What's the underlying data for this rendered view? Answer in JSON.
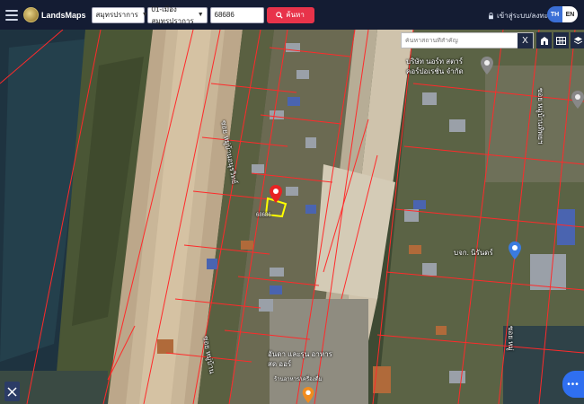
{
  "header": {
    "app_name": "LandsMaps",
    "province_select": "สมุทรปราการ",
    "district_select": "01-เมืองสมุทรปราการ",
    "parcel_number": "68686",
    "search_button": "ค้นหา",
    "login_link": "เข้าสู่ระบบ/ลงทะเบียน",
    "lang_th": "TH",
    "lang_en": "EN"
  },
  "map": {
    "place_search_placeholder": "ค้นหาสถานที่สำคัญ",
    "close_label": "X",
    "labels": {
      "road_left": "ซอย หมู่บ้านอนุรวิทย์",
      "road_left_bottom": "ซอย หมู่บ้าน",
      "road_right_top": "ซอย หมู่บ้านทิพยฯ",
      "road_right_bottom": "ซอย หมู่",
      "company": "บริษัท นอร์ท สตาร์ คอร์ปอเรชั่น จำกัด",
      "poi_right": "บจก. นิรันดร์",
      "poi_bottom": "อันดา และรุน อาหาร สด ออร์",
      "poi_bottom_sub": "ร้านอาหาร/เครื่องดื่ม",
      "parcel": "68686"
    },
    "fab_label": "•••"
  }
}
